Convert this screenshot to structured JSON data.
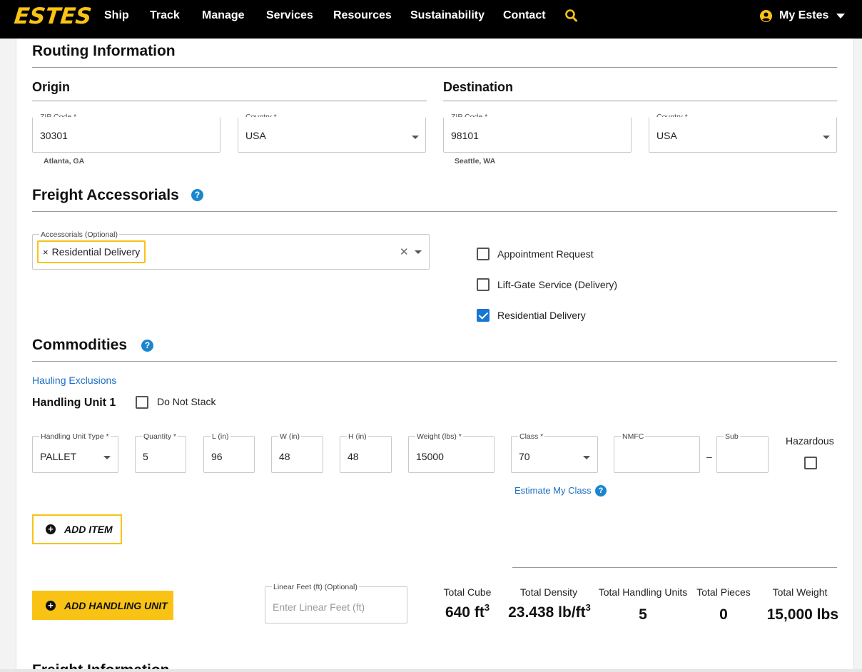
{
  "nav": {
    "logo": "ESTES",
    "links": [
      "Ship",
      "Track",
      "Manage",
      "Services",
      "Resources",
      "Sustainability",
      "Contact"
    ],
    "search_icon": "search-icon",
    "account_label": "My Estes"
  },
  "routing": {
    "title": "Routing Information",
    "origin": {
      "title": "Origin",
      "zip_label": "ZIP Code *",
      "zip_value": "30301",
      "city": "Atlanta, GA",
      "country_label": "Country *",
      "country_value": "USA"
    },
    "destination": {
      "title": "Destination",
      "zip_label": "ZIP Code *",
      "zip_value": "98101",
      "city": "Seattle, WA",
      "country_label": "Country *",
      "country_value": "USA"
    }
  },
  "accessorials": {
    "title": "Freight Accessorials",
    "field_label": "Accessorials (Optional)",
    "chip": "Residential Delivery",
    "chip_remove": "×",
    "clear_icon": "✕",
    "options": [
      {
        "label": "Appointment Request",
        "checked": false
      },
      {
        "label": "Lift-Gate Service (Delivery)",
        "checked": false
      },
      {
        "label": "Residential Delivery",
        "checked": true
      }
    ]
  },
  "commodities": {
    "title": "Commodities",
    "hauling_link": "Hauling Exclusions",
    "handling_unit_title": "Handling Unit 1",
    "do_not_stack": "Do Not Stack",
    "fields": {
      "unit_type_label": "Handling Unit Type *",
      "unit_type_value": "PALLET",
      "quantity_label": "Quantity *",
      "quantity_value": "5",
      "length_label": "L (in)",
      "length_value": "96",
      "width_label": "W (in)",
      "width_value": "48",
      "height_label": "H (in)",
      "height_value": "48",
      "weight_label": "Weight (lbs) *",
      "weight_value": "15000",
      "class_label": "Class *",
      "class_value": "70",
      "nmfc_label": "NMFC",
      "nmfc_value": "",
      "sub_label": "Sub",
      "sub_value": "",
      "dash": "–",
      "hazardous_label": "Hazardous"
    },
    "estimate_link": "Estimate My Class",
    "add_item": "ADD ITEM",
    "add_handling_unit": "ADD HANDLING UNIT",
    "linear_feet_label": "Linear Feet (ft) (Optional)",
    "linear_feet_placeholder": "Enter Linear Feet (ft)"
  },
  "totals": {
    "cube_label": "Total Cube",
    "cube_value": "640 ft",
    "cube_sup": "3",
    "density_label": "Total Density",
    "density_value": "23.438 lb/ft",
    "density_sup": "3",
    "units_label": "Total Handling Units",
    "units_value": "5",
    "pieces_label": "Total Pieces",
    "pieces_value": "0",
    "weight_label": "Total Weight",
    "weight_value": "15,000 lbs"
  },
  "next_section_title": "Freight Information",
  "colors": {
    "brand_yellow": "#f8c315",
    "nav_bg": "#000000",
    "link_blue": "#1b6fc2",
    "help_blue": "#1b86cf",
    "checkbox_blue": "#1976d2"
  }
}
